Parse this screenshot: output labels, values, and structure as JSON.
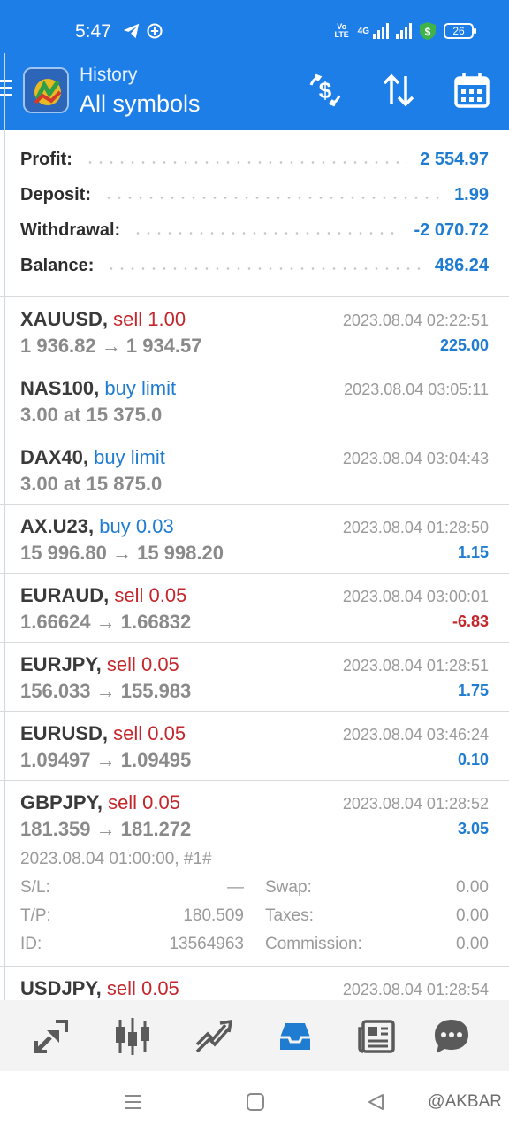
{
  "status_bar": {
    "time": "5:47",
    "volte": "Vo LTE",
    "network": "4G",
    "battery": "26"
  },
  "header": {
    "title": "History",
    "subtitle": "All symbols",
    "actions": [
      "currency-exchange-icon",
      "sort-icon",
      "calendar-icon"
    ]
  },
  "summary": {
    "profit_label": "Profit:",
    "profit_value": "2 554.97",
    "deposit_label": "Deposit:",
    "deposit_value": "1.99",
    "withdrawal_label": "Withdrawal:",
    "withdrawal_value": "-2 070.72",
    "balance_label": "Balance:",
    "balance_value": "486.24"
  },
  "trades": [
    {
      "symbol": "XAUUSD,",
      "action": "sell 1.00",
      "side": "sell",
      "price": "1 936.82 → 1 934.57",
      "time": "2023.08.04 02:22:51",
      "profit": "225.00",
      "profit_sign": "pos"
    },
    {
      "symbol": "NAS100,",
      "action": "buy limit",
      "side": "buy",
      "price": "3.00 at 15 375.0",
      "time": "2023.08.04 03:05:11",
      "profit": "",
      "profit_sign": "pos"
    },
    {
      "symbol": "DAX40,",
      "action": "buy limit",
      "side": "buy",
      "price": "3.00 at 15 875.0",
      "time": "2023.08.04 03:04:43",
      "profit": "",
      "profit_sign": "pos"
    },
    {
      "symbol": "AX.U23,",
      "action": "buy 0.03",
      "side": "buy",
      "price": "15 996.80 → 15 998.20",
      "time": "2023.08.04 01:28:50",
      "profit": "1.15",
      "profit_sign": "pos"
    },
    {
      "symbol": "EURAUD,",
      "action": "sell 0.05",
      "side": "sell",
      "price": "1.66624 → 1.66832",
      "time": "2023.08.04 03:00:01",
      "profit": "-6.83",
      "profit_sign": "neg"
    },
    {
      "symbol": "EURJPY,",
      "action": "sell 0.05",
      "side": "sell",
      "price": "156.033 → 155.983",
      "time": "2023.08.04 01:28:51",
      "profit": "1.75",
      "profit_sign": "pos"
    },
    {
      "symbol": "EURUSD,",
      "action": "sell 0.05",
      "side": "sell",
      "price": "1.09497 → 1.09495",
      "time": "2023.08.04 03:46:24",
      "profit": "0.10",
      "profit_sign": "pos"
    }
  ],
  "expanded_trade": {
    "symbol": "GBPJPY,",
    "action": "sell 0.05",
    "price": "181.359 → 181.272",
    "time": "2023.08.04 01:28:52",
    "profit": "3.05",
    "open_info": "2023.08.04 01:00:00, #1#",
    "sl_label": "S/L:",
    "sl_value": "—",
    "tp_label": "T/P:",
    "tp_value": "180.509",
    "id_label": "ID:",
    "id_value": "13564963",
    "swap_label": "Swap:",
    "swap_value": "0.00",
    "taxes_label": "Taxes:",
    "taxes_value": "0.00",
    "commission_label": "Commission:",
    "commission_value": "0.00"
  },
  "partial_trade": {
    "symbol": "USDJPY,",
    "action": "sell 0.05",
    "time": "2023.08.04 01:28:54"
  },
  "bottom_nav": [
    "quotes-icon",
    "chart-icon",
    "trade-icon",
    "history-icon",
    "news-icon",
    "chat-icon"
  ],
  "watermark": "@AKBAR",
  "colors": {
    "header_bg": "#1e7ee8",
    "positive": "#1f7cd1",
    "negative": "#c3262b",
    "active_nav": "#1f7cd1"
  }
}
